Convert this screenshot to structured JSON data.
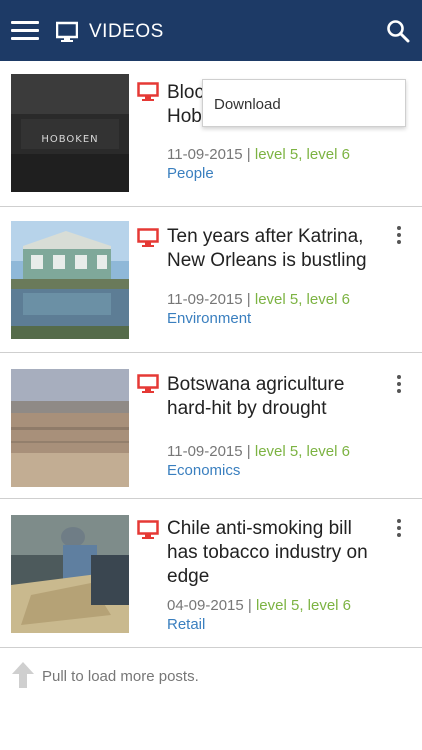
{
  "header": {
    "title": "VIDEOS",
    "menu_icon": "hamburger-menu-icon",
    "section_icon": "monitor-icon",
    "search_icon": "search-icon",
    "background_color": "#1d3a66"
  },
  "posts": [
    {
      "title": "Bloc\nHob",
      "date": "11-09-2015",
      "separator": " | ",
      "levels": "level 5, level 6",
      "category": "People",
      "thumbnail_text": "HOBOKEN"
    },
    {
      "title": "Ten years after Katrina, New Orleans is bustling",
      "date": "11-09-2015",
      "separator": " | ",
      "levels": "level 5, level 6",
      "category": "Environment"
    },
    {
      "title": "Botswana agriculture hard-hit by drought",
      "date": "11-09-2015",
      "separator": " | ",
      "levels": "level 5, level 6",
      "category": "Economics"
    },
    {
      "title": "Chile anti-smoking bill has tobacco industry on edge",
      "date": "04-09-2015",
      "separator": " | ",
      "levels": "level 5, level 6",
      "category": "Retail"
    }
  ],
  "popup_menu": {
    "items": [
      "Download"
    ]
  },
  "footer": {
    "label": "Pull to load more posts."
  },
  "colors": {
    "level_text": "#7cb342",
    "category_text": "#3a7fbf",
    "video_icon": "#e53935"
  }
}
